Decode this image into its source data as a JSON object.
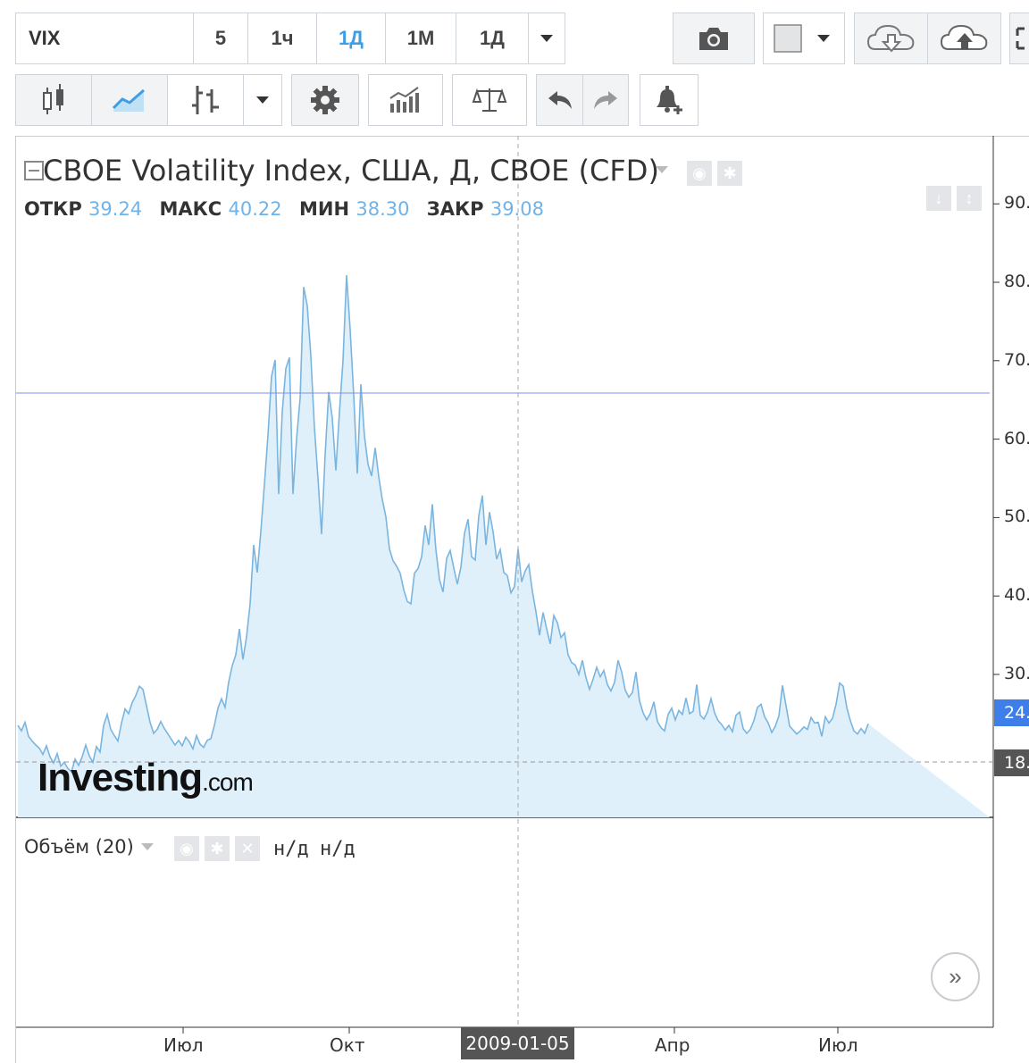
{
  "toolbar": {
    "symbol": "VIX",
    "intervals": [
      {
        "label": "5"
      },
      {
        "label": "1ч"
      },
      {
        "label": "1Д",
        "active": true
      },
      {
        "label": "1М"
      },
      {
        "label": "1Д"
      }
    ]
  },
  "legend": {
    "title": "CBOE Volatility Index, США, Д, CBOE (CFD)",
    "open_label": "ОТКР",
    "open": "39.24",
    "high_label": "МАКС",
    "high": "40.22",
    "low_label": "МИН",
    "low": "38.30",
    "close_label": "ЗАКР",
    "close": "39.08"
  },
  "volume": {
    "title": "Объём (20)",
    "na1": "н/д",
    "na2": "н/д"
  },
  "logo": {
    "main": "Investing",
    "suffix": ".com"
  },
  "crosshair": {
    "date": "2009-01-05"
  },
  "price_tags": [
    {
      "label": "24.",
      "color": "#3d7ee8"
    },
    {
      "label": "18.",
      "color": "#555555"
    }
  ],
  "colors": {
    "line": "#7ab5e0",
    "fill": "#dff0fa",
    "accent": "#3d9ee6"
  },
  "chart_data": {
    "type": "area",
    "x_ticks": [
      "Июл",
      "Окт",
      "Апр",
      "Июл"
    ],
    "y_ticks": [
      "90.",
      "80.",
      "70.",
      "60.",
      "50.",
      "40.",
      "30."
    ],
    "ylim": [
      10,
      95
    ],
    "x": [
      0,
      4,
      8,
      12,
      16,
      20,
      24,
      28,
      32,
      36,
      40,
      44,
      48,
      52,
      56,
      60,
      64,
      68,
      72,
      76,
      80,
      84,
      88,
      92,
      96,
      100,
      104,
      108,
      112,
      116,
      120,
      124,
      128,
      132,
      136,
      140,
      144,
      148,
      152,
      156,
      160,
      164,
      168,
      172,
      176,
      180,
      184,
      188,
      192,
      196,
      200,
      204,
      208,
      212,
      216,
      220,
      224,
      228,
      232,
      236,
      240,
      244,
      248,
      252,
      256,
      260,
      264,
      268,
      272,
      276,
      280,
      284,
      288,
      292,
      296,
      300,
      304,
      308,
      312,
      316,
      320,
      324,
      328,
      332,
      336,
      340,
      344,
      348,
      352,
      356,
      360,
      364,
      368,
      372,
      376,
      380,
      384,
      388,
      392,
      396,
      400,
      404,
      408,
      412,
      416,
      420,
      424,
      428,
      432,
      436,
      440,
      444,
      448,
      452,
      456,
      460,
      464,
      468,
      472,
      476,
      480,
      484,
      488,
      492,
      496,
      500,
      504,
      508,
      512,
      516,
      520,
      524,
      528,
      532,
      536,
      540,
      544,
      548,
      552,
      556,
      560,
      564,
      568,
      572,
      576,
      580,
      584,
      588,
      592,
      596,
      600,
      604,
      608,
      612,
      616,
      620,
      624,
      628,
      632,
      636,
      640,
      644,
      648,
      652,
      656,
      660,
      664,
      668,
      672,
      676,
      680,
      684,
      688,
      692,
      696,
      700,
      704,
      708,
      712,
      716,
      720,
      724,
      728,
      732,
      736,
      740,
      744,
      748,
      752,
      756,
      760,
      764,
      768,
      772,
      776,
      780,
      784,
      788,
      792,
      796,
      800,
      804,
      808,
      812,
      816,
      820,
      824,
      828,
      832,
      836,
      840,
      844,
      848,
      852,
      856,
      860,
      864,
      868,
      872,
      876,
      880,
      884,
      888,
      892,
      896,
      900,
      904,
      908,
      912,
      916,
      920,
      924,
      928,
      932,
      936,
      940,
      944,
      948,
      952,
      956,
      960,
      964,
      968,
      972,
      976,
      980,
      984,
      988,
      992,
      996,
      1000,
      1004,
      1008,
      1012,
      1016,
      1020,
      1024,
      1028,
      1032,
      1036,
      1040,
      1044,
      1048,
      1052,
      1056,
      1060,
      1064,
      1068,
      1072,
      1076,
      1080,
      1084,
      1088
    ],
    "values": [
      23.5,
      22.8,
      23.9,
      22.1,
      21.5,
      21.0,
      20.6,
      19.8,
      20.9,
      19.5,
      18.7,
      19.9,
      18.3,
      18.8,
      18.0,
      17.6,
      19.2,
      18.4,
      19.5,
      21.0,
      19.6,
      18.8,
      20.8,
      20.1,
      23.5,
      24.9,
      23.0,
      22.2,
      21.5,
      23.8,
      25.6,
      25.0,
      26.4,
      27.3,
      28.5,
      28.1,
      26.0,
      23.9,
      22.5,
      23.0,
      24.0,
      23.1,
      22.4,
      21.7,
      21.0,
      21.6,
      20.9,
      22.0,
      21.4,
      20.5,
      22.2,
      21.1,
      20.7,
      21.6,
      21.8,
      23.5,
      25.7,
      26.9,
      25.8,
      29.0,
      31.1,
      32.5,
      35.8,
      31.9,
      34.8,
      39.0,
      46.5,
      43.0,
      48.2,
      54.2,
      60.5,
      68.0,
      70.1,
      53.0,
      63.5,
      69.0,
      70.4,
      53.0,
      60.0,
      65.2,
      79.4,
      77.0,
      70.6,
      61.5,
      55.0,
      47.9,
      58.0,
      66.0,
      62.7,
      56.0,
      63.4,
      70.0,
      80.9,
      74.0,
      65.6,
      55.6,
      67.0,
      60.4,
      56.8,
      55.3,
      58.9,
      55.2,
      52.3,
      50.1,
      46.0,
      44.5,
      43.8,
      42.9,
      40.8,
      39.3,
      39.0,
      42.9,
      43.5,
      45.0,
      49.0,
      46.5,
      51.7,
      45.9,
      42.1,
      40.5,
      44.8,
      45.8,
      43.6,
      41.5,
      43.7,
      48.0,
      49.8,
      45.0,
      44.6,
      50.2,
      52.8,
      46.5,
      50.7,
      48.2,
      44.7,
      45.9,
      43.0,
      42.6,
      40.4,
      41.2,
      46.0,
      41.8,
      43.2,
      44.0,
      40.6,
      38.0,
      35.0,
      37.9,
      35.8,
      33.9,
      37.5,
      36.6,
      34.7,
      35.3,
      32.5,
      31.5,
      31.2,
      30.0,
      31.8,
      29.6,
      28.1,
      29.4,
      30.9,
      29.7,
      30.5,
      28.7,
      27.9,
      29.0,
      31.8,
      30.3,
      28.0,
      27.1,
      27.7,
      30.3,
      26.6,
      25.1,
      24.2,
      25.0,
      26.5,
      24.0,
      23.2,
      22.8,
      24.9,
      25.7,
      24.2,
      25.4,
      24.9,
      27.0,
      25.0,
      25.3,
      28.7,
      24.8,
      24.3,
      25.2,
      26.9,
      25.1,
      24.1,
      23.6,
      22.9,
      23.5,
      22.7,
      24.8,
      25.2,
      23.1,
      22.5,
      23.0,
      24.1,
      25.8,
      26.2,
      24.6,
      23.8,
      22.6,
      23.4,
      24.7,
      28.6,
      26.0,
      23.4,
      22.9,
      22.4,
      22.8,
      23.3,
      23.0,
      24.5,
      23.8,
      23.9,
      22.1,
      24.6,
      23.8,
      24.4,
      26.2,
      28.9,
      28.5,
      25.8,
      24.1,
      22.8,
      22.4,
      23.1,
      22.5,
      23.7
    ]
  }
}
